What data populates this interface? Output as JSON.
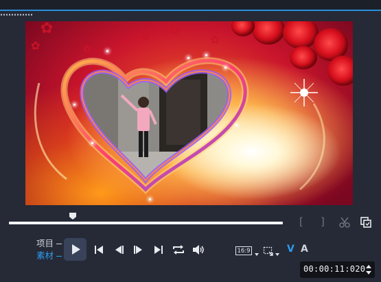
{
  "preview": {
    "description_icons": [
      "heart-frame",
      "rose",
      "lens-flare"
    ]
  },
  "timeline": {
    "progress": 0.235,
    "mark_in_label": "[",
    "mark_out_label": "]"
  },
  "mode": {
    "project_label": "项目",
    "clip_label": "素材",
    "active": "clip"
  },
  "controls": {
    "play_icon": "play-icon",
    "aspect_ratio": "16:9"
  },
  "track_toggle": {
    "video_label": "V",
    "audio_label": "A"
  },
  "timecode": {
    "value": "00:00:11:020"
  },
  "colors": {
    "accent": "#2f9bf0",
    "panel": "#252a36",
    "timeline": "#f2f4f7"
  }
}
